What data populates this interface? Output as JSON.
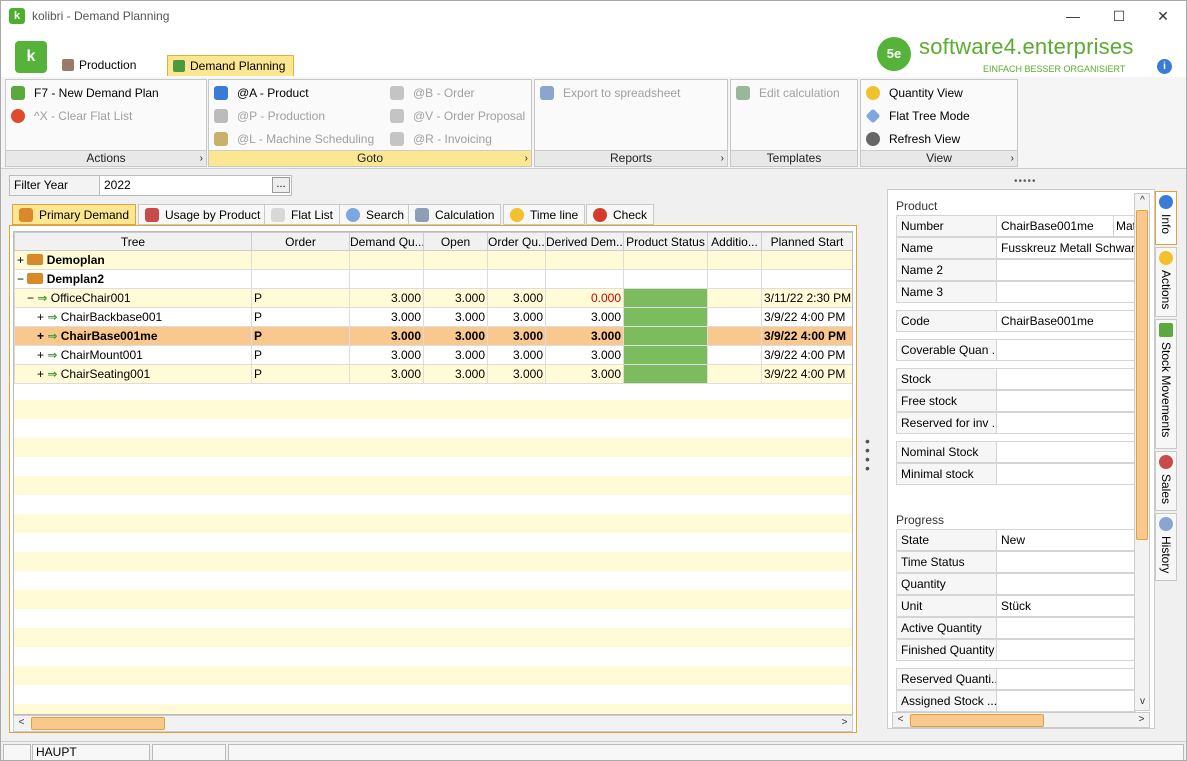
{
  "window": {
    "title": "kolibri - Demand Planning",
    "app_icon": "kolibri-logo-icon",
    "min_glyph": "—",
    "max_glyph": "☐",
    "close_glyph": "✕"
  },
  "ribbon_tabs": [
    {
      "label": "Production",
      "icon": "factory-icon"
    },
    {
      "label": "Demand Planning",
      "icon": "demand-planning-icon"
    }
  ],
  "brand": {
    "mark": "5e",
    "name": "software4.enterprises",
    "tagline": "EINFACH BESSER ORGANISIERT",
    "info_glyph": "i"
  },
  "groups": {
    "actions": {
      "title": "Actions",
      "items": [
        "F7 - New Demand Plan",
        "^X - Clear Flat List"
      ]
    },
    "goto": {
      "title": "Goto",
      "items": [
        "@A - Product",
        "@P - Production",
        "@L - Machine Scheduling",
        "@B - Order",
        "@V - Order Proposal",
        "@R - Invoicing"
      ]
    },
    "reports": {
      "title": "Reports",
      "items": [
        "Export to spreadsheet"
      ]
    },
    "templates": {
      "title": "Templates",
      "items": [
        "Edit calculation"
      ]
    },
    "view": {
      "title": "View",
      "items": [
        "Quantity View",
        "Flat Tree Mode",
        "Refresh View"
      ]
    },
    "more_glyph": "›"
  },
  "filter": {
    "label": "Filter Year",
    "value": "2022",
    "button": "..."
  },
  "splitter": "•••••",
  "tabs": [
    "Primary Demand",
    "Usage by Product",
    "Flat List",
    "Search",
    "Calculation",
    "Time line",
    "Check"
  ],
  "grid": {
    "columns": [
      "Tree",
      "Order",
      "Demand Qu...",
      "Open",
      "Order Qu...",
      "Derived Dem...",
      "Product Status",
      "Additio...",
      "Planned Start"
    ],
    "rows": [
      {
        "tree": "Demoplan",
        "order": "",
        "dq": "",
        "open": "",
        "oq": "",
        "derived": "",
        "extra": "",
        "start": ""
      },
      {
        "tree": "Demplan2",
        "order": "",
        "dq": "",
        "open": "",
        "oq": "",
        "derived": "",
        "extra": "",
        "start": ""
      },
      {
        "tree": "OfficeChair001",
        "order": "P",
        "dq": "3.000",
        "open": "3.000",
        "oq": "3.000",
        "derived": "0.000",
        "extra": "",
        "start": "3/11/22 2:30 PM"
      },
      {
        "tree": "ChairBackbase001",
        "order": "P",
        "dq": "3.000",
        "open": "3.000",
        "oq": "3.000",
        "derived": "3.000",
        "extra": "",
        "start": "3/9/22 4:00 PM"
      },
      {
        "tree": "ChairBase001me",
        "order": "P",
        "dq": "3.000",
        "open": "3.000",
        "oq": "3.000",
        "derived": "3.000",
        "extra": "",
        "start": "3/9/22 4:00 PM"
      },
      {
        "tree": "ChairMount001",
        "order": "P",
        "dq": "3.000",
        "open": "3.000",
        "oq": "3.000",
        "derived": "3.000",
        "extra": "",
        "start": "3/9/22 4:00 PM"
      },
      {
        "tree": "ChairSeating001",
        "order": "P",
        "dq": "3.000",
        "open": "3.000",
        "oq": "3.000",
        "derived": "3.000",
        "extra": "",
        "start": "3/9/22 4:00 PM"
      }
    ],
    "expand_glyphs": {
      "plus": "+",
      "minus": "−"
    },
    "arrow_glyph": "⇒",
    "scroll_left": "<",
    "scroll_right": ">"
  },
  "panel": {
    "section1": "Product",
    "rows1": [
      [
        "Number",
        "ChairBase001me"
      ],
      [
        "Name",
        "Fusskreuz Metall Schwarz"
      ],
      [
        "Name 2",
        ""
      ],
      [
        "Name 3",
        ""
      ],
      [
        "Code",
        "ChairBase001me"
      ],
      [
        "Coverable Quan ...",
        ""
      ],
      [
        "Stock",
        ""
      ],
      [
        "Free stock",
        ""
      ],
      [
        "Reserved for inv ...",
        ""
      ],
      [
        "Nominal Stock",
        ""
      ],
      [
        "Minimal stock",
        ""
      ]
    ],
    "number_extra": "Mat",
    "section2": "Progress",
    "rows2": [
      [
        "State",
        "New"
      ],
      [
        "Time Status",
        ""
      ],
      [
        "Quantity",
        ""
      ],
      [
        "Unit",
        "Stück"
      ],
      [
        "Active Quantity",
        ""
      ],
      [
        "Finished Quantity",
        ""
      ],
      [
        "Reserved Quanti...",
        ""
      ],
      [
        "Assigned Stock ...",
        ""
      ]
    ],
    "scroll_up": "^",
    "scroll_down": "v",
    "scroll_left": "<",
    "scroll_right": ">"
  },
  "side_tabs": [
    "Info",
    "Actions",
    "Stock Movements",
    "Sales",
    "History"
  ],
  "status": {
    "seg1": "",
    "seg2": "HAUPT",
    "seg3": "",
    "seg4": ""
  },
  "colors": {
    "accent": "#fbe792",
    "selection": "#f8c88e",
    "brand": "#55b33a",
    "status_ok": "#7cbc5e"
  }
}
